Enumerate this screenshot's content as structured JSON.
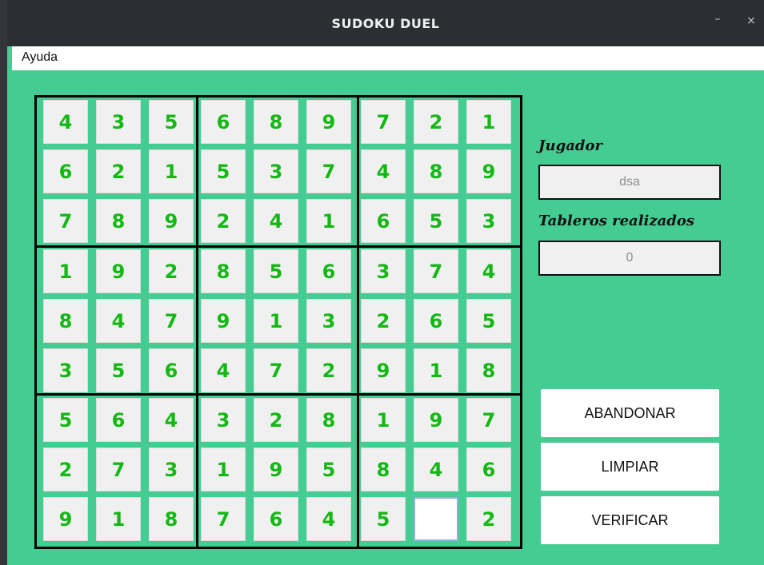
{
  "window": {
    "title": "SUDOKU DUEL",
    "minimize_label": "–",
    "close_label": "×"
  },
  "menu": {
    "items": [
      "Ayuda"
    ]
  },
  "board": {
    "rows": [
      [
        "4",
        "3",
        "5",
        "6",
        "8",
        "9",
        "7",
        "2",
        "1"
      ],
      [
        "6",
        "2",
        "1",
        "5",
        "3",
        "7",
        "4",
        "8",
        "9"
      ],
      [
        "7",
        "8",
        "9",
        "2",
        "4",
        "1",
        "6",
        "5",
        "3"
      ],
      [
        "1",
        "9",
        "2",
        "8",
        "5",
        "6",
        "3",
        "7",
        "4"
      ],
      [
        "8",
        "4",
        "7",
        "9",
        "1",
        "3",
        "2",
        "6",
        "5"
      ],
      [
        "3",
        "5",
        "6",
        "4",
        "7",
        "2",
        "9",
        "1",
        "8"
      ],
      [
        "5",
        "6",
        "4",
        "3",
        "2",
        "8",
        "1",
        "9",
        "7"
      ],
      [
        "2",
        "7",
        "3",
        "1",
        "9",
        "5",
        "8",
        "4",
        "6"
      ],
      [
        "9",
        "1",
        "8",
        "7",
        "6",
        "4",
        "5",
        "",
        "2"
      ]
    ],
    "digit_color": "#14b814",
    "focused_cell_border": "#93aee8"
  },
  "side": {
    "player_label": "Jugador",
    "player_value": "dsa",
    "boards_label": "Tableros realizados",
    "boards_value": "0"
  },
  "buttons": {
    "abandon": "ABANDONAR",
    "clear": "LIMPIAR",
    "verify": "VERIFICAR"
  },
  "colors": {
    "background": "#45cc92",
    "titlebar": "#2b2e33"
  }
}
